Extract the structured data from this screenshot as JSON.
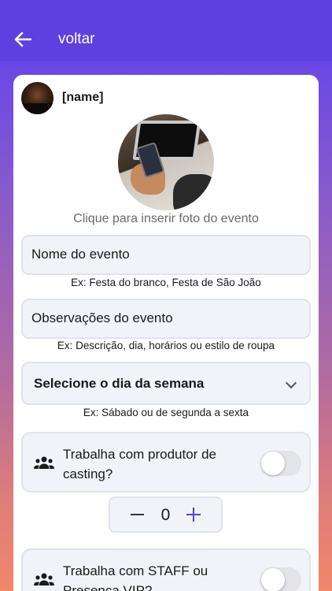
{
  "header": {
    "title": "voltar"
  },
  "profile": {
    "name": "[name]"
  },
  "photo": {
    "caption": "Clique para inserir foto do evento"
  },
  "fields": {
    "name": {
      "label": "Nome do evento",
      "hint": "Ex: Festa do branco, Festa de São João"
    },
    "notes": {
      "label": "Observações do evento",
      "hint": "Ex: Descrição, dia,  horários ou estilo de roupa"
    },
    "weekday": {
      "label": "Selecione o dia da semana",
      "hint": "Ex: Sábado ou de segunda a sexta"
    }
  },
  "casting": {
    "label": "Trabalha com produtor de casting?",
    "enabled": false,
    "count": "0"
  },
  "staff": {
    "label": "Trabalha com STAFF ou Presença VIP?",
    "enabled": false
  },
  "colors": {
    "primary": "#5e3fe0",
    "accent": "#5a3fd9"
  }
}
